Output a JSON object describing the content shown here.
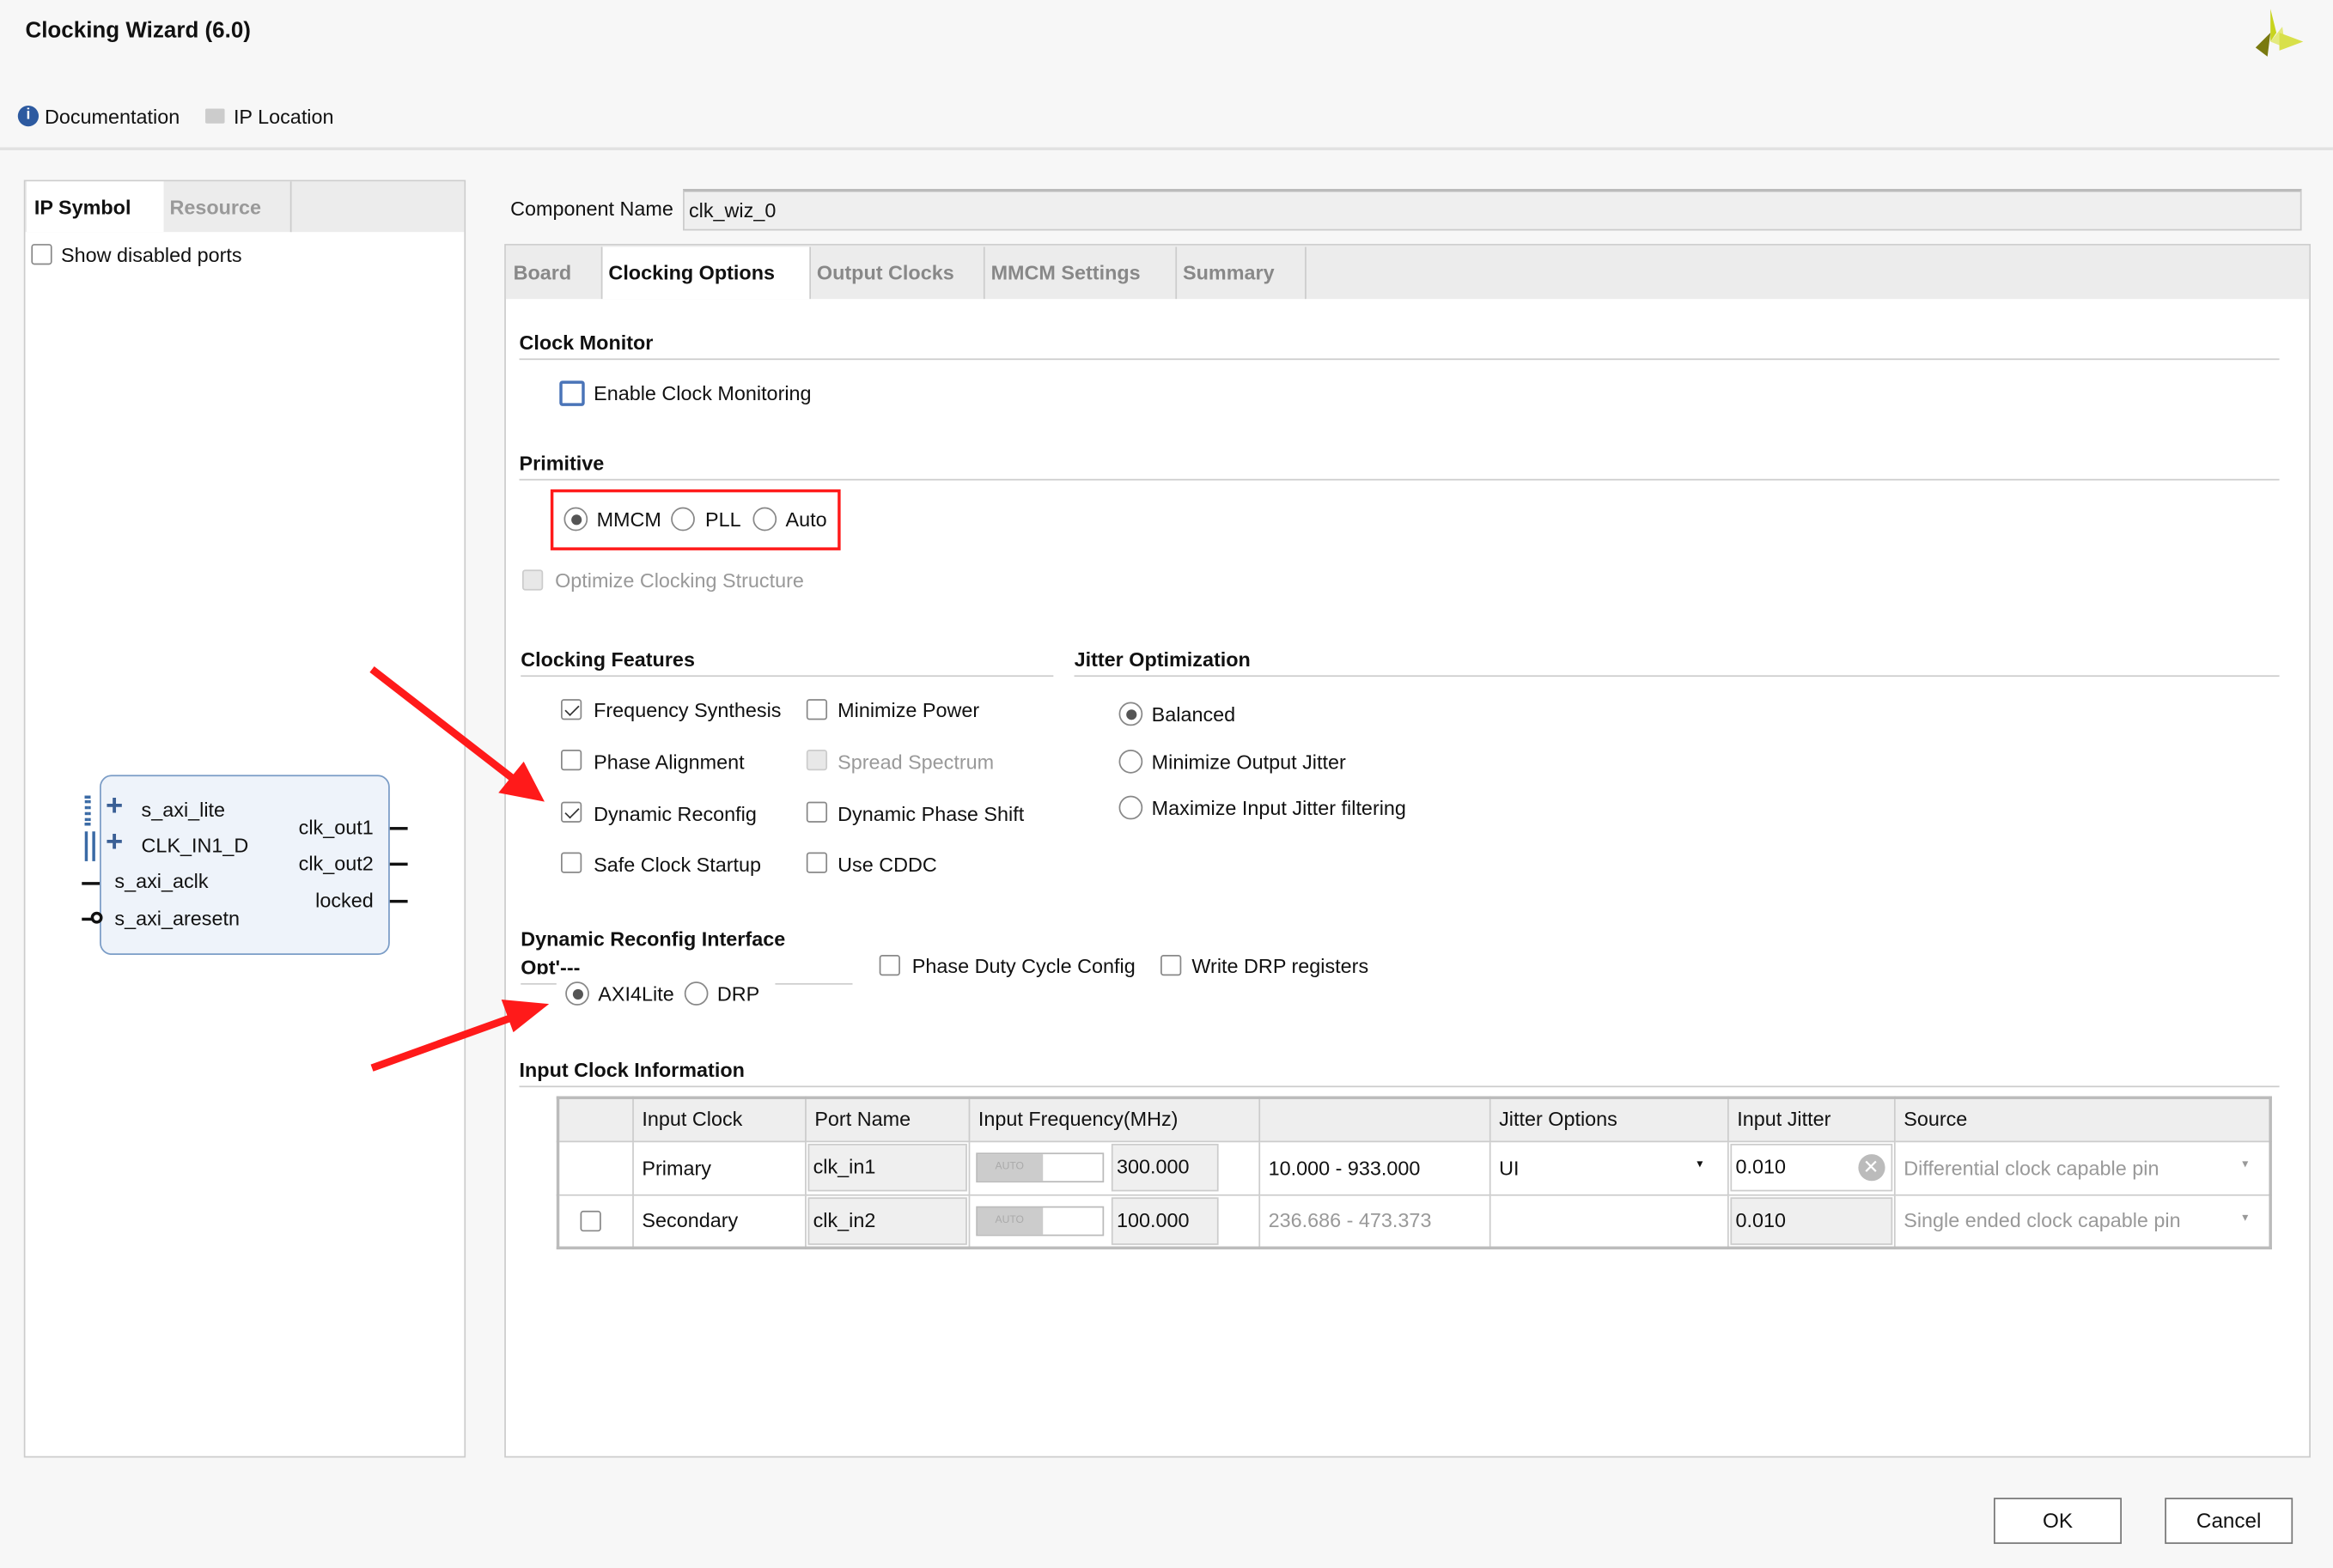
{
  "window": {
    "title": "Clocking Wizard (6.0)"
  },
  "toolbar": {
    "documentation": "Documentation",
    "ip_location": "IP Location"
  },
  "left_panel": {
    "tabs": [
      "IP Symbol",
      "Resource"
    ],
    "show_disabled_ports": "Show disabled ports",
    "symbol": {
      "left_ports": [
        "s_axi_lite",
        "CLK_IN1_D",
        "s_axi_aclk",
        "s_axi_aresetn"
      ],
      "right_ports": [
        "clk_out1",
        "clk_out2",
        "locked"
      ]
    }
  },
  "component": {
    "label": "Component Name",
    "value": "clk_wiz_0"
  },
  "tabs": [
    "Board",
    "Clocking Options",
    "Output Clocks",
    "MMCM Settings",
    "Summary"
  ],
  "active_tab": "Clocking Options",
  "clock_monitor": {
    "title": "Clock Monitor",
    "enable": "Enable Clock Monitoring"
  },
  "primitive": {
    "title": "Primitive",
    "options": [
      "MMCM",
      "PLL",
      "Auto"
    ],
    "selected": "MMCM",
    "optimize": "Optimize Clocking Structure"
  },
  "features": {
    "title": "Clocking Features",
    "items": [
      {
        "label": "Frequency Synthesis",
        "checked": true
      },
      {
        "label": "Minimize Power",
        "checked": false
      },
      {
        "label": "Phase Alignment",
        "checked": false
      },
      {
        "label": "Spread Spectrum",
        "checked": false,
        "disabled": true
      },
      {
        "label": "Dynamic Reconfig",
        "checked": true
      },
      {
        "label": "Dynamic Phase Shift",
        "checked": false
      },
      {
        "label": "Safe Clock Startup",
        "checked": false
      },
      {
        "label": "Use CDDC",
        "checked": false
      }
    ]
  },
  "jitter": {
    "title": "Jitter Optimization",
    "options": [
      "Balanced",
      "Minimize Output Jitter",
      "Maximize Input Jitter filtering"
    ],
    "selected": "Balanced"
  },
  "dri": {
    "title": "Dynamic Reconfig Interface",
    "title2": "Opt'---",
    "options": [
      "AXI4Lite",
      "DRP"
    ],
    "selected": "AXI4Lite",
    "phase_duty": "Phase Duty Cycle Config",
    "write_drp": "Write DRP registers"
  },
  "input_clock": {
    "title": "Input Clock Information",
    "headers": [
      "",
      "Input Clock",
      "Port Name",
      "Input Frequency(MHz)",
      "",
      "Jitter Options",
      "Input Jitter",
      "Source"
    ],
    "rows": [
      {
        "clock": "Primary",
        "port": "clk_in1",
        "auto": "AUTO",
        "freq": "300.000",
        "range": "10.000 - 933.000",
        "jitter_opt": "UI",
        "jitter": "0.010",
        "source": "Differential clock capable pin"
      },
      {
        "clock": "Secondary",
        "port": "clk_in2",
        "auto": "AUTO",
        "freq": "100.000",
        "range": "236.686 - 473.373",
        "jitter_opt": "",
        "jitter": "0.010",
        "source": "Single ended clock capable pin"
      }
    ]
  },
  "buttons": {
    "ok": "OK",
    "cancel": "Cancel"
  },
  "colors": {
    "annotation": "#ff1a1a",
    "accent": "#4a74b8"
  }
}
